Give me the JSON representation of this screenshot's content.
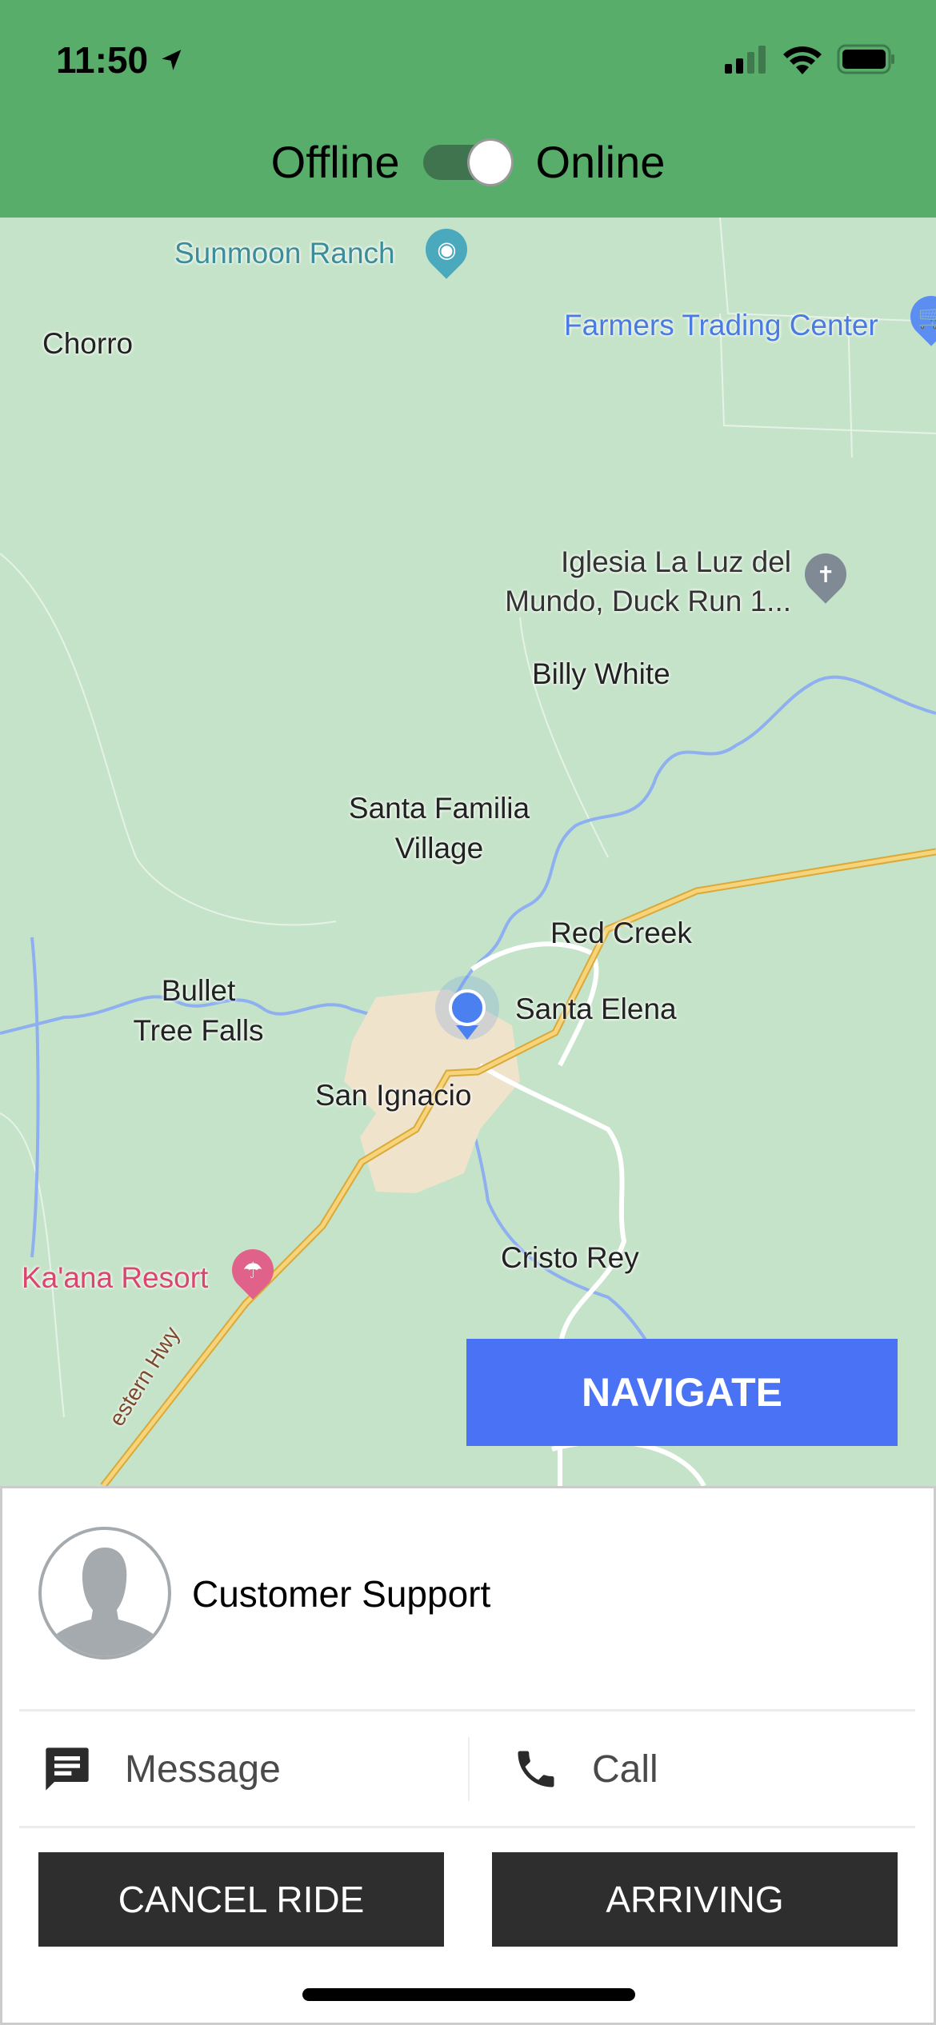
{
  "status_bar": {
    "time": "11:50",
    "icons": [
      "location-arrow-icon",
      "signal-icon",
      "wifi-icon",
      "battery-icon"
    ]
  },
  "header": {
    "offline_label": "Offline",
    "online_label": "Online",
    "online": true,
    "color": "#57ad69"
  },
  "map": {
    "labels": {
      "sunmoon": "Sunmoon Ranch",
      "chorro": "Chorro",
      "farmers": "Farmers Trading Center",
      "iglesia1": "Iglesia La Luz del",
      "iglesia2": "Mundo, Duck Run 1...",
      "billy": "Billy White",
      "familia1": "Santa Familia",
      "familia2": "Village",
      "redcreek": "Red Creek",
      "bullet1": "Bullet",
      "bullet2": "Tree Falls",
      "elena": "Santa Elena",
      "ignacio": "San Ignacio",
      "cristo": "Cristo Rey",
      "kaana": "Ka'ana Resort",
      "hwy": "estern Hwy"
    },
    "colors": {
      "land": "#c5e3c8",
      "road": "#f2c14e",
      "water": "#8fb0f0",
      "town": "#efe3cc",
      "location": "#4a80f0"
    }
  },
  "navigate_label": "NAVIGATE",
  "contact": {
    "name": "Customer Support",
    "message_label": "Message",
    "call_label": "Call"
  },
  "buttons": {
    "cancel": "CANCEL RIDE",
    "arriving": "ARRIVING"
  }
}
